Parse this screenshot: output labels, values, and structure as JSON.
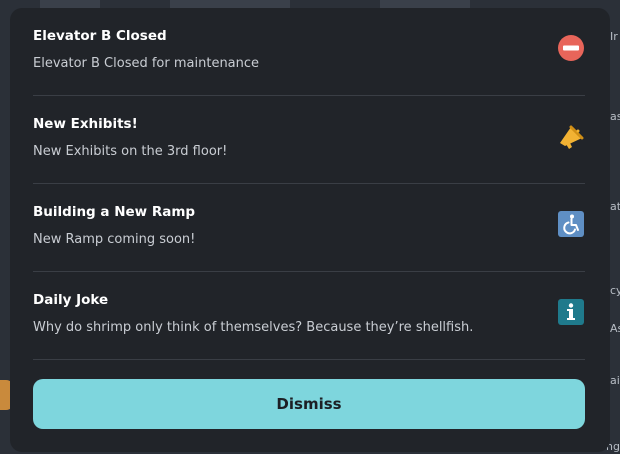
{
  "notices": [
    {
      "title": "Elevator B Closed",
      "body": "Elevator B Closed for maintenance",
      "icon": "no-entry-icon",
      "icon_color": "#e8655a"
    },
    {
      "title": "New Exhibits!",
      "body": "New Exhibits on the 3rd floor!",
      "icon": "megaphone-icon",
      "icon_color": "#f2b233"
    },
    {
      "title": "Building a New Ramp",
      "body": "New Ramp coming soon!",
      "icon": "wheelchair-icon",
      "icon_color": "#5f8fc4"
    },
    {
      "title": "Daily Joke",
      "body": "Why do shrimp only think of themselves? Because they’re shellfish.",
      "icon": "info-icon",
      "icon_color": "#1f7a8c"
    }
  ],
  "dismiss_label": "Dismiss",
  "dismiss_color": "#7ed6dd",
  "background_edge_text": [
    "Ir",
    "as",
    "at",
    "cy",
    "As",
    "ai",
    "ng"
  ]
}
